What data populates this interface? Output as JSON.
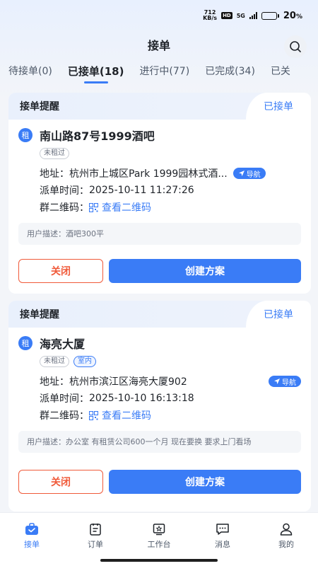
{
  "status_bar": {
    "net_speed_value": "712",
    "net_speed_unit": "KB/s",
    "hd_badge": "HD",
    "network": "5G",
    "battery_percent": "20",
    "battery_unit": "%",
    "battery_level": 0.2
  },
  "header": {
    "title": "接单",
    "search_icon": "search-icon"
  },
  "tabs": [
    {
      "label": "待接单(0)"
    },
    {
      "label": "已接单(18)"
    },
    {
      "label": "进行中(77)"
    },
    {
      "label": "已完成(34)"
    },
    {
      "label": "已关"
    }
  ],
  "active_tab": "已接单(18)",
  "orders": [
    {
      "header_title": "接单提醒",
      "status": "已接单",
      "badge": "租",
      "name": "南山路87号1999酒吧",
      "tags": [
        "未租过"
      ],
      "address_label": "地址：",
      "address": "杭州市上城区Park 1999园林式酒...",
      "nav_label": "导航",
      "time_label": "派单时间：",
      "time": "2025-10-11 11:27:26",
      "qr_label": "群二维码：",
      "qr_link": "查看二维码",
      "description": "用户描述：酒吧300平",
      "close_label": "关闭",
      "create_label": "创建方案"
    },
    {
      "header_title": "接单提醒",
      "status": "已接单",
      "badge": "租",
      "name": "海亮大厦",
      "tags": [
        "未租过",
        "室内"
      ],
      "address_label": "地址：",
      "address": "杭州市滨江区海亮大厦902",
      "nav_label": "导航",
      "time_label": "派单时间：",
      "time": "2025-10-10 16:13:18",
      "qr_label": "群二维码：",
      "qr_link": "查看二维码",
      "description": "用户描述：办公室 有租赁公司600一个月 现在要换 要求上门看场",
      "close_label": "关闭",
      "create_label": "创建方案"
    }
  ],
  "bottom_nav": [
    {
      "label": "接单",
      "icon": "briefcase-icon",
      "active": true
    },
    {
      "label": "订单",
      "icon": "order-list-icon",
      "active": false
    },
    {
      "label": "工作台",
      "icon": "workbench-icon",
      "active": false
    },
    {
      "label": "消息",
      "icon": "message-icon",
      "active": false
    },
    {
      "label": "我的",
      "icon": "profile-icon",
      "active": false
    }
  ],
  "colors": {
    "accent": "#3a7cf6",
    "danger": "#f05a3a",
    "background": "#f3f5f9"
  }
}
